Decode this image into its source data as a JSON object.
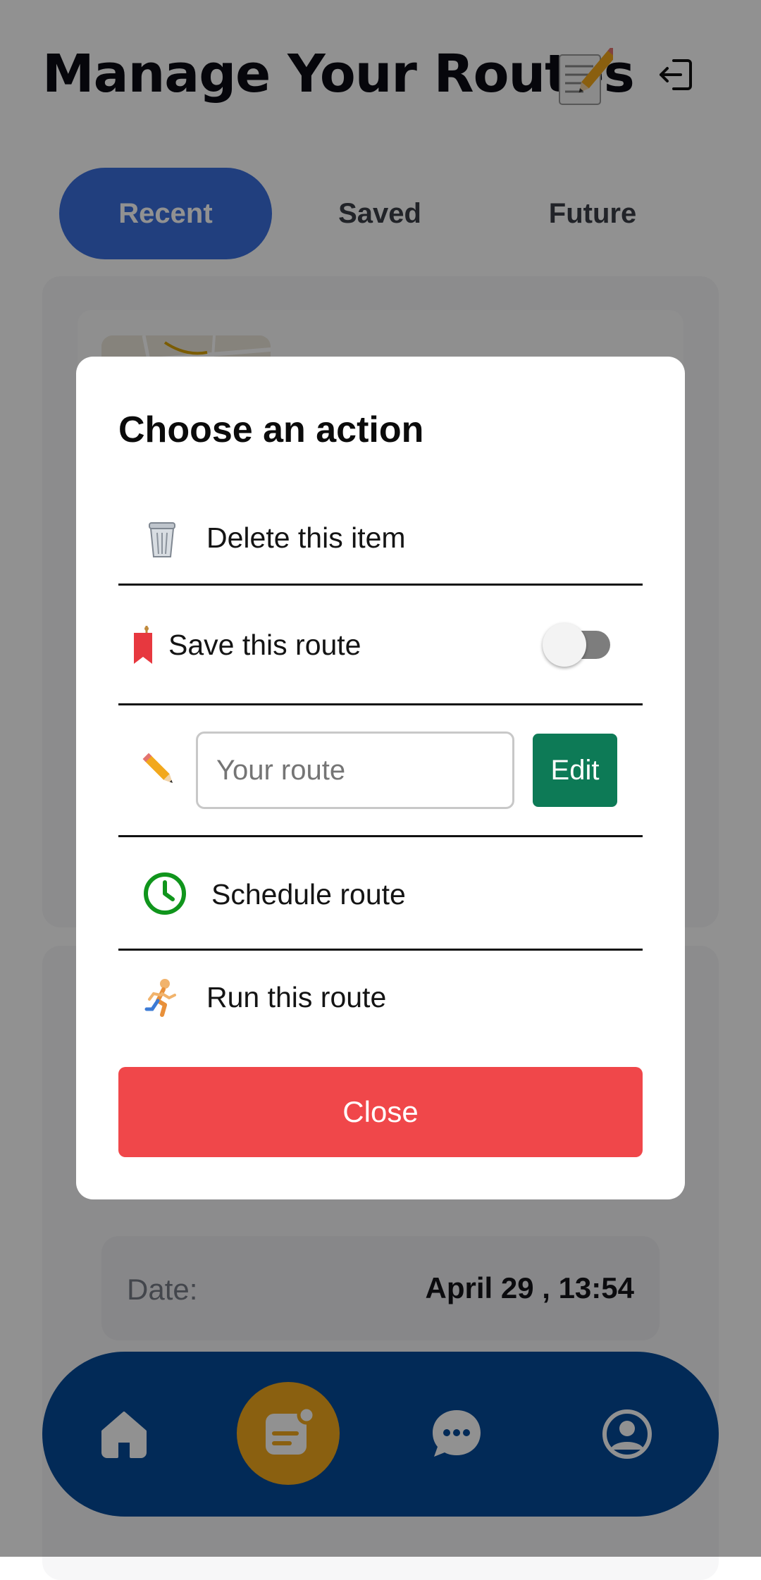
{
  "header": {
    "title": "Manage Your Routes",
    "title_emoji_icon": "memo-pencil-icon",
    "logout_icon": "logout-icon"
  },
  "tabs": [
    {
      "label": "Recent",
      "active": true
    },
    {
      "label": "Saved",
      "active": false
    },
    {
      "label": "Future",
      "active": false
    }
  ],
  "route_card": {
    "date_label": "Date:",
    "date_value": "April 29 , 13:54"
  },
  "modal": {
    "title": "Choose an action",
    "delete_label": "Delete this item",
    "save_label": "Save this route",
    "save_toggle_on": false,
    "route_name_placeholder": "Your route",
    "edit_label": "Edit",
    "schedule_label": "Schedule route",
    "run_label": "Run this route",
    "close_label": "Close"
  },
  "bottom_nav": [
    {
      "icon": "home-icon"
    },
    {
      "icon": "routes-icon",
      "active": true
    },
    {
      "icon": "chat-icon"
    },
    {
      "icon": "profile-icon"
    }
  ],
  "colors": {
    "active_tab": "#3b6fde",
    "nav_bar": "#054a9a",
    "nav_active": "#f3a91d",
    "edit_button": "#0d7a56",
    "close_button": "#f0474a",
    "clock_icon": "#10951c"
  }
}
